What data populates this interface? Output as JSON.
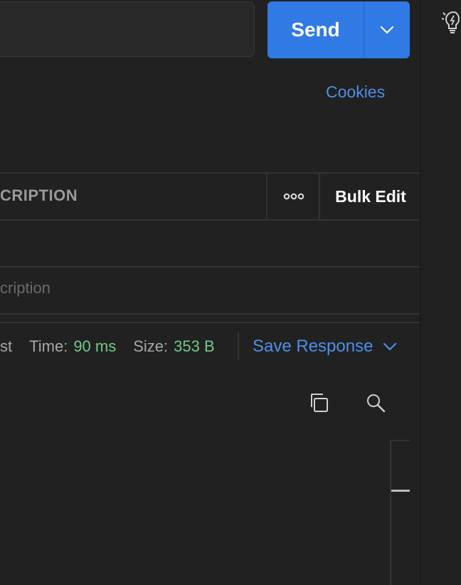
{
  "request": {
    "url_value": "",
    "send_label": "Send",
    "cookies_label": "Cookies"
  },
  "params_table": {
    "description_header": "CRIPTION",
    "bulk_edit_label": "Bulk Edit",
    "description_placeholder": "cription"
  },
  "response_meta": {
    "status_fragment": "st",
    "time_label": "Time:",
    "time_value": "90 ms",
    "size_label": "Size:",
    "size_value": "353 B",
    "save_response_label": "Save Response"
  },
  "icons": {
    "send_dropdown": "chevron-down-icon",
    "more_options": "more-horizontal-icon",
    "save_dropdown": "chevron-down-icon",
    "copy": "copy-icon",
    "search": "search-icon",
    "bulb": "lightbulb-icon"
  },
  "colors": {
    "background": "#212121",
    "accent": "#2f7ae5",
    "link": "#4f8fe8",
    "success": "#74c98a"
  }
}
